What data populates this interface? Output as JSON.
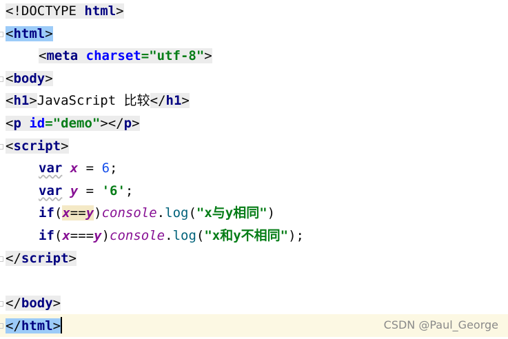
{
  "editor": {
    "lines": [
      {
        "doctype_open": "<!DOCTYPE ",
        "doctype_html": "html",
        "doctype_close": ">"
      },
      {
        "lt": "<",
        "name": "html",
        "gt": ">"
      },
      {
        "lt": "<",
        "name": "meta",
        "attr": "charset",
        "eq": "=",
        "value": "\"utf-8\"",
        "gt": ">"
      },
      {
        "lt": "<",
        "name": "body",
        "gt": ">"
      },
      {
        "open_lt": "<",
        "open_name": "h1",
        "open_gt": ">",
        "text": "JavaScript 比较",
        "close_lt": "</",
        "close_name": "h1",
        "close_gt": ">"
      },
      {
        "open_lt": "<",
        "open_name": "p",
        "attr": "id",
        "eq": "=",
        "value": "\"demo\"",
        "mid": "></",
        "close_name": "p",
        "close_gt": ">"
      },
      {
        "lt": "<",
        "name": "script",
        "gt": ">"
      },
      {
        "kw": "var",
        "sp1": " ",
        "var": "x",
        "op": " = ",
        "num": "6",
        "semi": ";"
      },
      {
        "kw": "var",
        "sp1": " ",
        "var": "y",
        "op": " = ",
        "str": "'6'",
        "semi": ";"
      },
      {
        "kw": "if",
        "lparen": "(",
        "cond_a": "x",
        "cond_op": "==",
        "cond_b": "y",
        "rparen": ")",
        "obj": "console",
        "dot": ".",
        "fn": "log",
        "open": "(",
        "str": "\"x与y相同\"",
        "close": ")"
      },
      {
        "kw": "if",
        "lparen": "(",
        "cond_a": "x",
        "cond_op": "===",
        "cond_b": "y",
        "rparen": ")",
        "obj": "console",
        "dot": ".",
        "fn": "log",
        "open": "(",
        "str": "\"x和y不相同\"",
        "close": ");"
      },
      {
        "lt": "</",
        "name": "script",
        "gt": ">"
      },
      {},
      {
        "lt": "</",
        "name": "body",
        "gt": ">"
      },
      {
        "lt": "</",
        "name": "html",
        "gt": ">"
      }
    ]
  },
  "watermark": "CSDN @Paul_George",
  "colors": {
    "tag": "#000080",
    "attribute": "#0000ff",
    "string": "#067d17",
    "number": "#1750eb",
    "variable": "#871094",
    "function": "#00627a",
    "current_line": "#fcf8e3",
    "brace_match": "#9ccbf8"
  },
  "icons": [
    "fold-marker-icon"
  ]
}
